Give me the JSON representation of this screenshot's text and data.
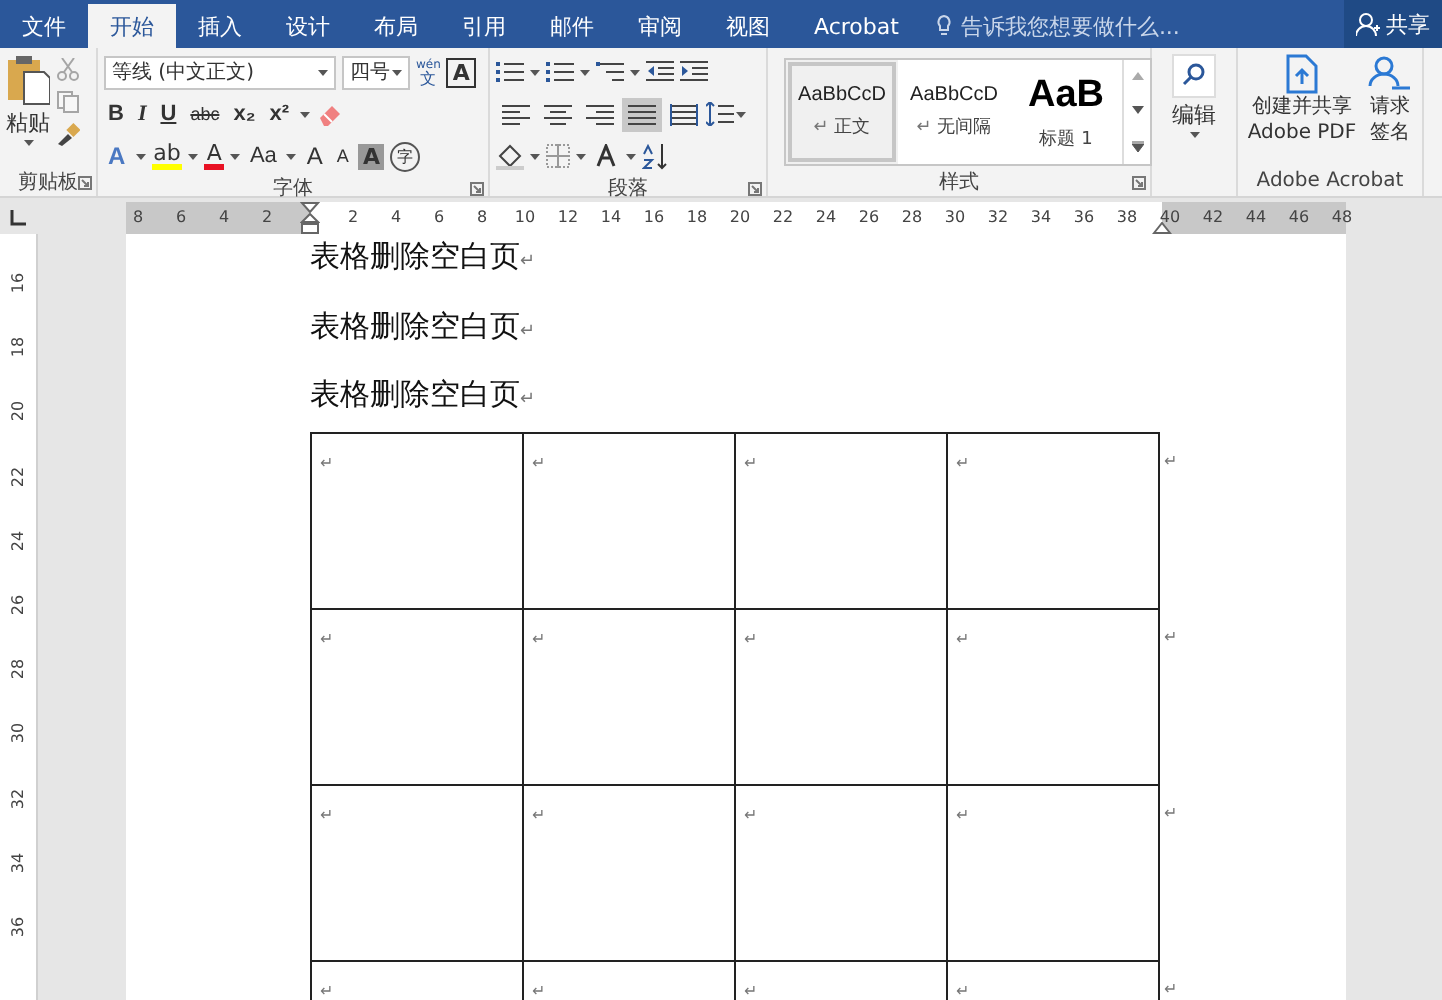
{
  "tabs": [
    {
      "label": "文件",
      "selected": false
    },
    {
      "label": "开始",
      "selected": true
    },
    {
      "label": "插入",
      "selected": false
    },
    {
      "label": "设计",
      "selected": false
    },
    {
      "label": "布局",
      "selected": false
    },
    {
      "label": "引用",
      "selected": false
    },
    {
      "label": "邮件",
      "selected": false
    },
    {
      "label": "审阅",
      "selected": false
    },
    {
      "label": "视图",
      "selected": false
    },
    {
      "label": "Acrobat",
      "selected": false
    }
  ],
  "tell_me": {
    "placeholder": "告诉我您想要做什么..."
  },
  "share": {
    "label": "共享"
  },
  "ribbon": {
    "clipboard": {
      "label": "剪贴板",
      "paste": "粘贴",
      "tools": [
        {
          "kind": "cut",
          "disabled": true
        },
        {
          "kind": "copy",
          "disabled": true
        },
        {
          "kind": "painter",
          "disabled": false
        }
      ]
    },
    "font": {
      "label": "字体",
      "name": "等线 (中文正文)",
      "size": "四号",
      "phonetic_top": "wén",
      "phonetic_bottom": "文",
      "char_border": "A",
      "format_buttons": [
        {
          "label": "B",
          "kind": "bold"
        },
        {
          "label": "I",
          "kind": "italic"
        },
        {
          "label": "U",
          "kind": "underline"
        },
        {
          "label": "abc",
          "kind": "strike"
        },
        {
          "label": "x₂",
          "kind": "plain"
        },
        {
          "label": "x²",
          "kind": "plain"
        }
      ],
      "effects": "A",
      "highlight": {
        "label": "ab",
        "color": "#ffff00"
      },
      "font_color": {
        "label": "A",
        "color": "#e81123"
      },
      "change_case": "Aa",
      "grow": "A",
      "shrink": "A",
      "shading": "A",
      "enclose": "字"
    },
    "paragraph": {
      "label": "段落",
      "alignments": [
        {
          "kind": "left",
          "selected": false
        },
        {
          "kind": "center",
          "selected": false
        },
        {
          "kind": "right",
          "selected": false
        },
        {
          "kind": "justify",
          "selected": true
        },
        {
          "kind": "distributed",
          "selected": false
        }
      ]
    },
    "styles": {
      "label": "样式",
      "items": [
        {
          "preview": "AaBbCcD",
          "mark": "↵",
          "name": "正文",
          "kind": "normal",
          "selected": true
        },
        {
          "preview": "AaBbCcD",
          "mark": "↵",
          "name": "无间隔",
          "kind": "normal",
          "selected": false
        },
        {
          "preview": "AaB",
          "name": "标题 1",
          "kind": "heading",
          "selected": false
        }
      ]
    },
    "editing": {
      "label": "编辑"
    },
    "acrobat": {
      "label": "Adobe Acrobat",
      "buttons": [
        {
          "kind": "pdf",
          "lines": [
            "创建并共享",
            "Adobe PDF"
          ]
        },
        {
          "kind": "sign",
          "lines": [
            "请求",
            "签名"
          ]
        }
      ]
    }
  },
  "ruler": {
    "horizontal": [
      "8",
      "6",
      "4",
      "2",
      "2",
      "4",
      "6",
      "8",
      "10",
      "12",
      "14",
      "16",
      "18",
      "20",
      "22",
      "24",
      "26",
      "28",
      "30",
      "32",
      "34",
      "36",
      "38",
      "40",
      "42",
      "44",
      "46",
      "48"
    ],
    "vertical": [
      "16",
      "18",
      "20",
      "22",
      "24",
      "26",
      "28",
      "30",
      "32",
      "34",
      "36"
    ]
  },
  "document": {
    "paragraphs": [
      {
        "text": "表格删除空白页",
        "mark": "↵"
      },
      {
        "text": "表格删除空白页",
        "mark": "↵"
      },
      {
        "text": "表格删除空白页",
        "mark": "↵"
      }
    ],
    "table": {
      "rows": [
        {
          "cells": [
            "↵",
            "↵",
            "↵",
            "↵"
          ],
          "end_mark": "↵"
        },
        {
          "cells": [
            "↵",
            "↵",
            "↵",
            "↵"
          ],
          "end_mark": "↵"
        },
        {
          "cells": [
            "↵",
            "↵",
            "↵",
            "↵"
          ],
          "end_mark": "↵"
        },
        {
          "cells": [
            "↵",
            "↵",
            "↵",
            "↵"
          ],
          "end_mark": "↵"
        }
      ]
    }
  }
}
